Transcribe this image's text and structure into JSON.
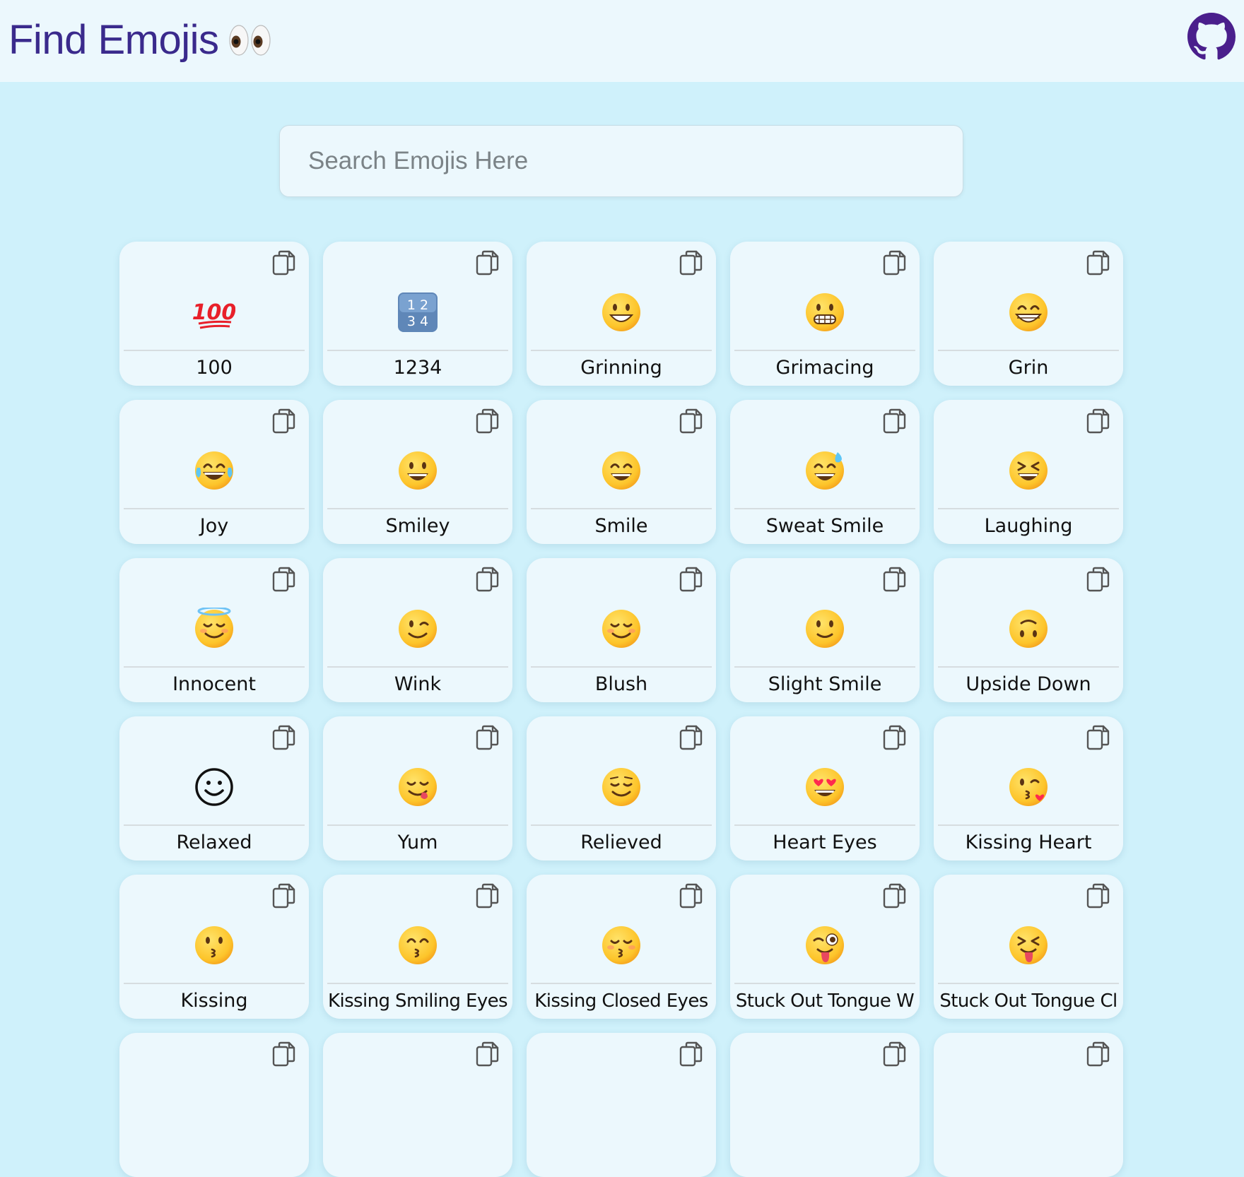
{
  "app": {
    "title": "Find Emojis",
    "title_icon": "eyes-emoji-icon",
    "repo_icon": "github-icon"
  },
  "search": {
    "placeholder": "Search Emojis Here",
    "value": ""
  },
  "colors": {
    "page_background": "#cff1fb",
    "header_background": "#ecf8fd",
    "card_background": "#ecf8fd",
    "title_color": "#3a2a8c",
    "emoji_yellow": "#fdc52b"
  },
  "emojis": [
    {
      "label": "100",
      "icon": "hundred-points-icon"
    },
    {
      "label": "1234",
      "icon": "input-numbers-icon"
    },
    {
      "label": "Grinning",
      "icon": "grinning-face-icon"
    },
    {
      "label": "Grimacing",
      "icon": "grimacing-face-icon"
    },
    {
      "label": "Grin",
      "icon": "grin-face-icon"
    },
    {
      "label": "Joy",
      "icon": "joy-face-icon"
    },
    {
      "label": "Smiley",
      "icon": "smiley-face-icon"
    },
    {
      "label": "Smile",
      "icon": "smile-face-icon"
    },
    {
      "label": "Sweat Smile",
      "icon": "sweat-smile-face-icon"
    },
    {
      "label": "Laughing",
      "icon": "laughing-face-icon"
    },
    {
      "label": "Innocent",
      "icon": "innocent-face-icon"
    },
    {
      "label": "Wink",
      "icon": "wink-face-icon"
    },
    {
      "label": "Blush",
      "icon": "blush-face-icon"
    },
    {
      "label": "Slight Smile",
      "icon": "slight-smile-face-icon"
    },
    {
      "label": "Upside Down",
      "icon": "upside-down-face-icon"
    },
    {
      "label": "Relaxed",
      "icon": "relaxed-face-icon"
    },
    {
      "label": "Yum",
      "icon": "yum-face-icon"
    },
    {
      "label": "Relieved",
      "icon": "relieved-face-icon"
    },
    {
      "label": "Heart Eyes",
      "icon": "heart-eyes-face-icon"
    },
    {
      "label": "Kissing Heart",
      "icon": "kissing-heart-face-icon"
    },
    {
      "label": "Kissing",
      "icon": "kissing-face-icon"
    },
    {
      "label": "Kissing Smiling Eyes",
      "icon": "kissing-smiling-eyes-face-icon"
    },
    {
      "label": "Kissing Closed Eyes",
      "icon": "kissing-closed-eyes-face-icon"
    },
    {
      "label": "Stuck Out Tongue W",
      "icon": "stuck-out-tongue-winking-face-icon"
    },
    {
      "label": "Stuck Out Tongue Cl",
      "icon": "stuck-out-tongue-closed-eyes-face-icon"
    },
    {
      "label": "",
      "icon": ""
    },
    {
      "label": "",
      "icon": ""
    },
    {
      "label": "",
      "icon": ""
    },
    {
      "label": "",
      "icon": ""
    },
    {
      "label": "",
      "icon": ""
    }
  ]
}
